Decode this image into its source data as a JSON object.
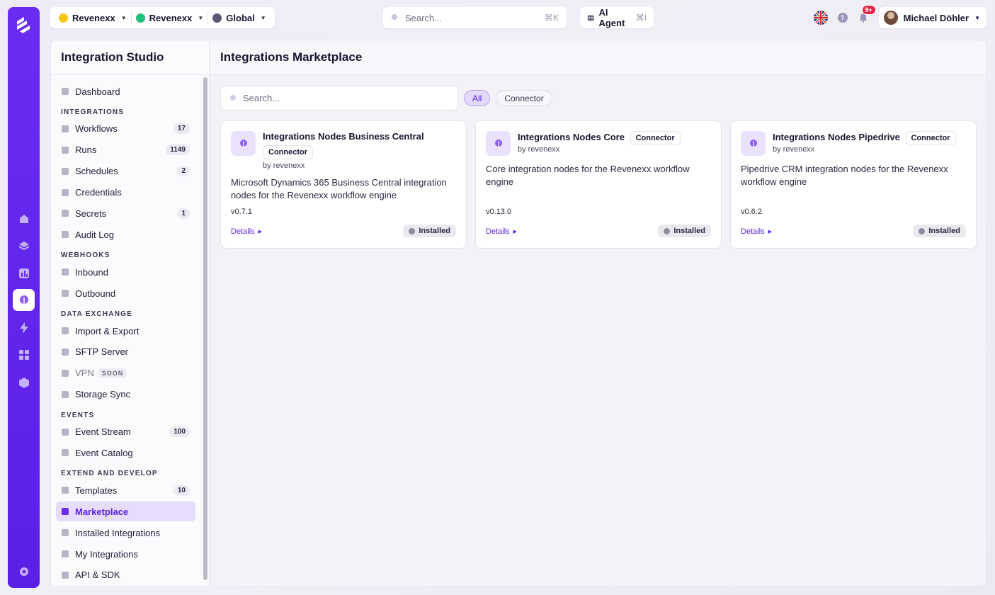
{
  "topbar": {
    "crumbs": [
      {
        "label": "Revenexx",
        "dot_color": "#f5c518"
      },
      {
        "label": "Revenexx",
        "dot_color": "#22c07a"
      },
      {
        "label": "Global",
        "dot_color": "#5a5670"
      }
    ],
    "search_placeholder": "Search...",
    "search_shortcut": "⌘K",
    "ai_agent_label": "AI Agent",
    "ai_agent_shortcut": "⌘I",
    "notifications_badge": "9+",
    "user_name": "Michael Döhler"
  },
  "sidebar": {
    "title": "Integration Studio",
    "sections": [
      {
        "heading": "",
        "items": [
          {
            "label": "Dashboard",
            "count": "",
            "icon": "home-icon"
          }
        ]
      },
      {
        "heading": "INTEGRATIONS",
        "items": [
          {
            "label": "Workflows",
            "count": "17",
            "icon": "workflow-icon"
          },
          {
            "label": "Runs",
            "count": "1149",
            "icon": "chart-icon"
          },
          {
            "label": "Schedules",
            "count": "2",
            "icon": "clock-icon"
          },
          {
            "label": "Credentials",
            "count": "",
            "icon": "shield-icon"
          },
          {
            "label": "Secrets",
            "count": "1",
            "icon": "key-icon"
          },
          {
            "label": "Audit Log",
            "count": "",
            "icon": "shield-check-icon"
          }
        ]
      },
      {
        "heading": "WEBHOOKS",
        "items": [
          {
            "label": "Inbound",
            "count": "",
            "icon": "link-icon"
          },
          {
            "label": "Outbound",
            "count": "",
            "icon": "send-icon"
          }
        ]
      },
      {
        "heading": "DATA EXCHANGE",
        "items": [
          {
            "label": "Import & Export",
            "count": "",
            "icon": "database-icon"
          },
          {
            "label": "SFTP Server",
            "count": "",
            "icon": "server-icon"
          },
          {
            "label": "VPN",
            "count": "",
            "icon": "vpn-icon",
            "soon": "SOON"
          },
          {
            "label": "Storage Sync",
            "count": "",
            "icon": "storage-icon"
          }
        ]
      },
      {
        "heading": "EVENTS",
        "items": [
          {
            "label": "Event Stream",
            "count": "100",
            "icon": "radio-icon"
          },
          {
            "label": "Event Catalog",
            "count": "",
            "icon": "book-icon"
          }
        ]
      },
      {
        "heading": "EXTEND AND DEVELOP",
        "items": [
          {
            "label": "Templates",
            "count": "10",
            "icon": "layers-icon"
          },
          {
            "label": "Marketplace",
            "count": "",
            "icon": "grid-icon",
            "active": true
          },
          {
            "label": "Installed Integrations",
            "count": "",
            "icon": "layers-icon"
          },
          {
            "label": "My Integrations",
            "count": "",
            "icon": "box-icon"
          },
          {
            "label": "API & SDK",
            "count": "",
            "icon": "code-icon"
          }
        ]
      }
    ]
  },
  "main": {
    "title": "Integrations Marketplace",
    "search_placeholder": "Search...",
    "filters": [
      "All",
      "Connector"
    ],
    "cards": [
      {
        "title": "Integrations Nodes Business Central",
        "tag": "Connector",
        "by": "by revenexx",
        "description": "Microsoft Dynamics 365 Business Central integration nodes for the Revenexx workflow engine",
        "version": "v0.7.1",
        "details": "Details",
        "status": "Installed"
      },
      {
        "title": "Integrations Nodes Core",
        "tag": "Connector",
        "by": "by revenexx",
        "description": "Core integration nodes for the Revenexx workflow engine",
        "version": "v0.13.0",
        "details": "Details",
        "status": "Installed"
      },
      {
        "title": "Integrations Nodes Pipedrive",
        "tag": "Connector",
        "by": "by revenexx",
        "description": "Pipedrive CRM integration nodes for the Revenexx workflow engine",
        "version": "v0.6.2",
        "details": "Details",
        "status": "Installed"
      }
    ]
  },
  "colors": {
    "brand": "#6a2cf0",
    "active_bg": "#e6dcfb",
    "badge": "#e2264a"
  }
}
